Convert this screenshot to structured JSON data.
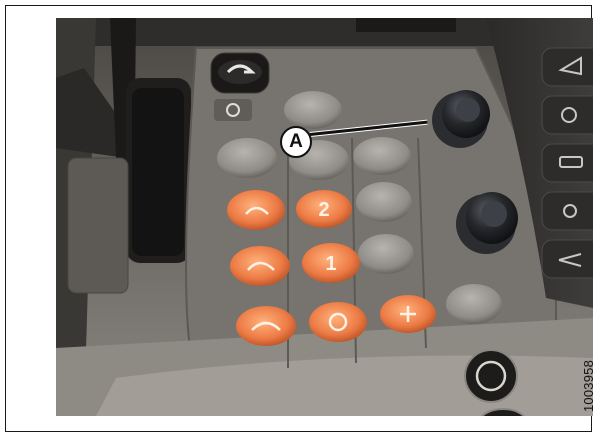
{
  "figure": {
    "callout_label": "A",
    "figure_id": "1003958"
  },
  "icons": {
    "top_button": "tool-symbol-icon",
    "left_panel": "shift-path-icon",
    "orange_buttons": [
      "speed-range-1-icon",
      "numeral-2-icon",
      "speed-range-2-icon",
      "numeral-1-icon",
      "speed-range-3-icon",
      "power-symbol-icon",
      "hazard-icon"
    ],
    "right_side": [
      "engine-icon",
      "oil-icon"
    ],
    "far_right": [
      "warning-icon",
      "search-icon",
      "car-icon",
      "fan-icon",
      "light-icon"
    ]
  },
  "colors": {
    "console": "#6b6762",
    "button_grey": "#908c87",
    "button_orange": "#e8763f",
    "knob": "#1d1f23"
  }
}
